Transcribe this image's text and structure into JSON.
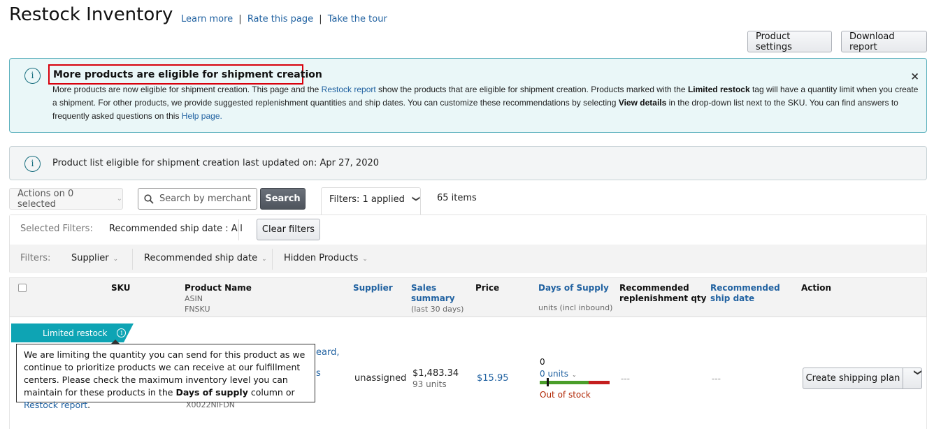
{
  "header": {
    "title": "Restock Inventory",
    "links": [
      "Learn more",
      "Rate this page",
      "Take the tour"
    ],
    "separator": "|",
    "buttons": {
      "product_settings": "Product settings",
      "download_report": "Download report"
    }
  },
  "alert": {
    "icon": "info-icon",
    "title": "More products are eligible for shipment creation",
    "body_1": "More products are now eligible for shipment creation. This page and the ",
    "link_restock": "Restock report",
    "body_2": " show the products that are eligible for shipment creation. Products marked with the ",
    "bold_limited": "Limited restock",
    "body_3": " tag will have a quantity limit when you create a shipment. For other products, we provide suggested replenishment quantities and ship dates. You can customize these recommendations by selecting ",
    "bold_view": "View details",
    "body_4": " in the drop-down list next to the SKU. You can find answers to frequently asked questions on this ",
    "link_help": "Help page.",
    "close": "×"
  },
  "update_notice": {
    "icon": "info-icon",
    "text": "Product list eligible for shipment creation last updated on: Apr 27, 2020"
  },
  "toolbar": {
    "actions_label": "Actions on 0 selected",
    "search_placeholder": "Search by merchant SKU, ASIN, FNSKU",
    "search_button": "Search",
    "filters_tab": "Filters: 1 applied",
    "items_count": "65 items"
  },
  "filters": {
    "selected_label": "Selected Filters:",
    "selected_value": "Recommended ship date : All",
    "clear_button": "Clear filters",
    "filters_label": "Filters:",
    "dropdowns": [
      "Supplier",
      "Recommended ship date",
      "Hidden Products"
    ]
  },
  "table": {
    "columns": {
      "sku": "SKU",
      "product_name": "Product Name",
      "product_sub1": "ASIN",
      "product_sub2": "FNSKU",
      "supplier": "Supplier",
      "sales_summary_1": "Sales",
      "sales_summary_2": "summary",
      "sales_sub": "(last 30 days)",
      "price": "Price",
      "days_of_supply": "Days of Supply",
      "dos_sub": "units (incl inbound)",
      "rec_qty_1": "Recommended",
      "rec_qty_2": "replenishment qty",
      "rec_ship_1": "Recommended",
      "rec_ship_2": "ship date",
      "action": "Action"
    },
    "rows": [
      {
        "badge": "Limited restock",
        "product_name_fragment": "eard,",
        "product_name_fragment2": "s",
        "fnsku": "X0022NIFDN",
        "supplier": "unassigned",
        "sales_amount": "$1,483.34",
        "sales_units": "93 units",
        "price": "$15.95",
        "days_of_supply": "0",
        "units_incl_inbound": "0 units",
        "supply_bar_green_fraction": 0.7,
        "supply_marker_fraction": 0.1,
        "stock_status": "Out of stock",
        "rec_qty": "---",
        "rec_ship_date": "---",
        "action_button": "Create shipping plan"
      }
    ]
  },
  "tooltip": {
    "text_1": "We are limiting the quantity you can send for this product as we continue to prioritize products we can receive at our fulfillment centers. Please check the maximum inventory level you can maintain for these products in the ",
    "bold": "Days of supply",
    "text_2": " column or ",
    "link": "Restock report",
    "text_3": "."
  }
}
